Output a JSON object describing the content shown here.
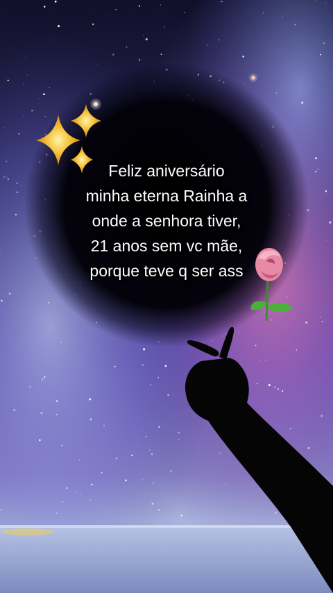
{
  "message": {
    "lines": [
      "Feliz aniversário",
      "minha eterna Rainha a",
      "onde a senhora tiver,",
      "21 anos sem vc mãe,",
      "porque teve q ser ass"
    ]
  },
  "decorations": {
    "sparkles_icon": "sparkles-icon",
    "rose_icon": "rose-icon"
  },
  "colors": {
    "sky_top": "#151433",
    "nebula_purple": "#6a4fb0",
    "nebula_pink": "#d86aa8",
    "sea": "#aab7d6",
    "sparkle": "#f6c23a",
    "rose_petal": "#e78aa5"
  }
}
